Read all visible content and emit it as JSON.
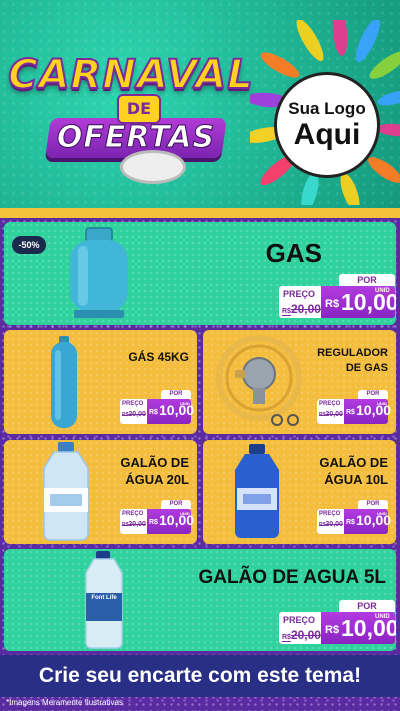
{
  "header": {
    "title_line1": "CARNAVAL",
    "title_de": "DE",
    "title_line2": "OFERTAS",
    "logo_line1": "Sua Logo",
    "logo_line2": "Aqui"
  },
  "colors": {
    "header_bg": "#1fb493",
    "card_green": "#2fd29d",
    "card_yellow": "#f4bd3e",
    "price_purple": "#9b2fd0",
    "footer_bg": "#2a2f86"
  },
  "products": [
    {
      "name": "GAS",
      "badge": "-50%",
      "por": "POR",
      "preco": "PREÇO",
      "old_prefix": "R$",
      "old_price": "20,00",
      "currency": "R$",
      "price": "10,00",
      "unit": "UNID",
      "image": "gas-cylinder-icon"
    },
    {
      "name": "GÁS 45KG",
      "por": "POR",
      "preco": "PREÇO",
      "old_prefix": "R$",
      "old_price": "20,00",
      "currency": "R$",
      "price": "10,00",
      "unit": "UNID",
      "image": "tall-gas-cylinder-icon"
    },
    {
      "name": "REGULADOR DE GAS",
      "por": "POR",
      "preco": "PREÇO",
      "old_prefix": "R$",
      "old_price": "20,00",
      "currency": "R$",
      "price": "10,00",
      "unit": "UNID",
      "image": "gas-regulator-icon"
    },
    {
      "name": "GALÃO DE ÁGUA 20L",
      "por": "POR",
      "preco": "PREÇO",
      "old_prefix": "R$",
      "old_price": "20,00",
      "currency": "R$",
      "price": "10,00",
      "unit": "UNID",
      "image": "water-jug-20l-icon"
    },
    {
      "name": "GALÃO DE ÁGUA 10L",
      "por": "POR",
      "preco": "PREÇO",
      "old_prefix": "R$",
      "old_price": "20,00",
      "currency": "R$",
      "price": "10,00",
      "unit": "UNID",
      "image": "water-jug-10l-icon"
    },
    {
      "name": "GALÃO DE AGUA 5L",
      "por": "POR",
      "preco": "PREÇO",
      "old_prefix": "R$",
      "old_price": "20,00",
      "currency": "R$",
      "price": "10,00",
      "unit": "UNID",
      "image": "water-bottle-5l-icon",
      "bottle_label": "Font Life"
    }
  ],
  "footer": {
    "cta": "Crie seu encarte com este tema!",
    "disclaimer": "*Imagens Meramente Ilustrativas"
  }
}
